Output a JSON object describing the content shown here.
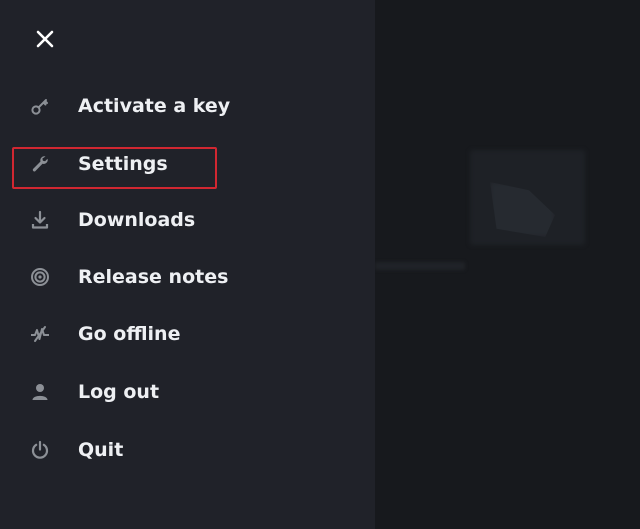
{
  "menu": {
    "close_icon": "close-icon",
    "items": [
      {
        "label": "Activate a key",
        "icon": "key-icon"
      },
      {
        "label": "Settings",
        "icon": "wrench-icon"
      },
      {
        "label": "Downloads",
        "icon": "download-icon"
      },
      {
        "label": "Release notes",
        "icon": "release-notes-icon"
      },
      {
        "label": "Go offline",
        "icon": "offline-icon"
      },
      {
        "label": "Log out",
        "icon": "user-icon"
      },
      {
        "label": "Quit",
        "icon": "power-icon"
      }
    ]
  },
  "highlight": {
    "target": "Settings",
    "color": "#d12731"
  },
  "colors": {
    "drawer_bg": "#202229",
    "backdrop_bg": "#17191d",
    "text": "#eef0f3",
    "icon": "#8c9096"
  }
}
